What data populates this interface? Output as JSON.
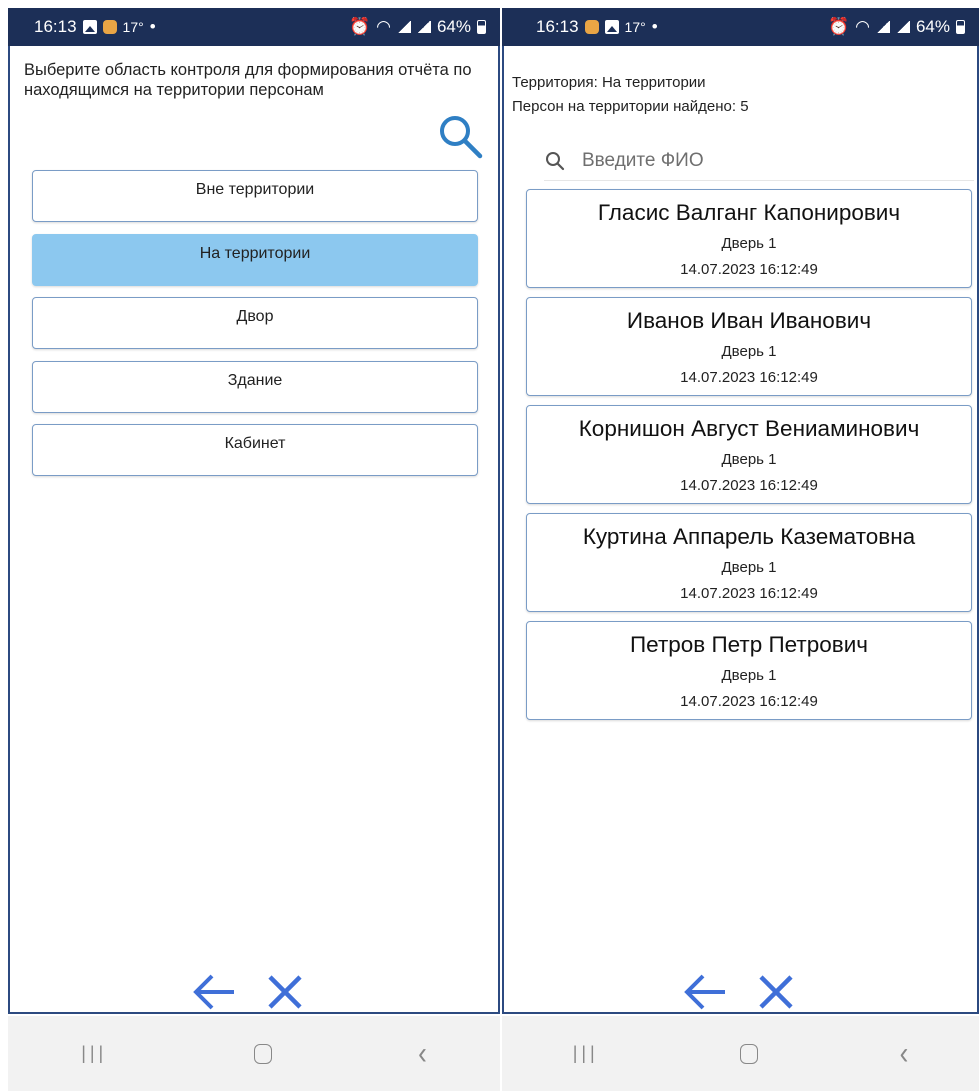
{
  "status_bar": {
    "left": {
      "time": "16:13",
      "temperature": "17°"
    },
    "right": {
      "battery": "64%"
    },
    "icons": [
      "gallery-icon",
      "app-icon",
      "alarm-icon",
      "wifi-icon",
      "signal-icon",
      "battery-icon"
    ]
  },
  "left_screen": {
    "instruction": "Выберите область контроля для формирования отчёта по находящимся на территории персонам",
    "zones": [
      {
        "label": "Вне территории",
        "selected": false
      },
      {
        "label": "На территории",
        "selected": true
      },
      {
        "label": "Двор",
        "selected": false
      },
      {
        "label": "Здание",
        "selected": false
      },
      {
        "label": "Кабинет",
        "selected": false
      }
    ]
  },
  "right_screen": {
    "territory_text": "Территория: На территории",
    "found_text": "Персон на территории найдено: 5",
    "search_placeholder": "Введите ФИО",
    "persons": [
      {
        "name": "Гласис Валганг Капонирович",
        "door": "Дверь 1",
        "time": "14.07.2023 16:12:49"
      },
      {
        "name": "Иванов Иван Иванович",
        "door": "Дверь 1",
        "time": "14.07.2023 16:12:49"
      },
      {
        "name": "Корнишон Август Вениаминович",
        "door": "Дверь 1",
        "time": "14.07.2023 16:12:49"
      },
      {
        "name": "Куртина Аппарель Казематовна",
        "door": "Дверь 1",
        "time": "14.07.2023 16:12:49"
      },
      {
        "name": "Петров Петр Петрович",
        "door": "Дверь 1",
        "time": "14.07.2023 16:12:49"
      }
    ]
  },
  "colors": {
    "status_bar": "#1c2f57",
    "accent_blue": "#3f6fd8",
    "selected_zone": "#8cc8ef",
    "border": "#7a9cc6"
  },
  "bottom_actions": [
    "back-arrow-icon",
    "close-icon"
  ]
}
